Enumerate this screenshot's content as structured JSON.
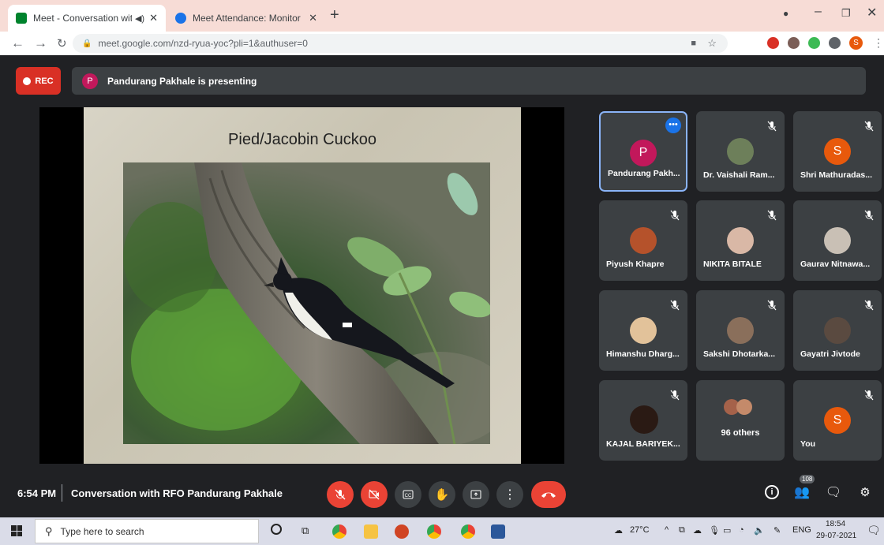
{
  "browser": {
    "tabs": [
      {
        "title": "Meet - Conversation with RF",
        "active": true
      },
      {
        "title": "Meet Attendance: Monitor",
        "active": false
      }
    ],
    "url": "meet.google.com/nzd-ryua-yoc?pli=1&authuser=0",
    "profile_initial": "S"
  },
  "meet": {
    "rec_label": "REC",
    "presenter_initial": "P",
    "presenting_text": "Pandurang Pakhale is presenting",
    "slide_title": "Pied/Jacobin Cuckoo",
    "participants": [
      {
        "name": "Pandurang Pakh...",
        "initial": "P",
        "color": "#c2185b"
      },
      {
        "name": "Dr. Vaishali Ram...",
        "initial": "",
        "color": "#6d7f5a"
      },
      {
        "name": "Shri Mathuradas...",
        "initial": "S",
        "color": "#e8590c"
      },
      {
        "name": "Piyush Khapre",
        "initial": "",
        "color": "#b5522b"
      },
      {
        "name": "NIKITA BITALE",
        "initial": "",
        "color": "#d9b8a6"
      },
      {
        "name": "Gaurav Nitnawa...",
        "initial": "",
        "color": "#c9c0b5"
      },
      {
        "name": "Himanshu Dharg...",
        "initial": "",
        "color": "#e2c29a"
      },
      {
        "name": "Sakshi Dhotarka...",
        "initial": "",
        "color": "#8a6f5b"
      },
      {
        "name": "Gayatri Jivtode",
        "initial": "",
        "color": "#5a4a40"
      },
      {
        "name": "KAJAL BARIYEK...",
        "initial": "",
        "color": "#2a1a14"
      },
      {
        "name": "96 others",
        "initial": "",
        "color": "#a5624a"
      },
      {
        "name": "You",
        "initial": "S",
        "color": "#e8590c"
      }
    ],
    "time": "6:54 PM",
    "meeting_title": "Conversation with RFO Pandurang Pakhale",
    "people_count": "108"
  },
  "taskbar": {
    "search_placeholder": "Type here to search",
    "weather": "27°C",
    "language": "ENG",
    "clock_time": "18:54",
    "clock_date": "29-07-2021"
  },
  "colors": {
    "red": "#ea4335",
    "bg": "#202124",
    "tile": "#3c4043"
  }
}
